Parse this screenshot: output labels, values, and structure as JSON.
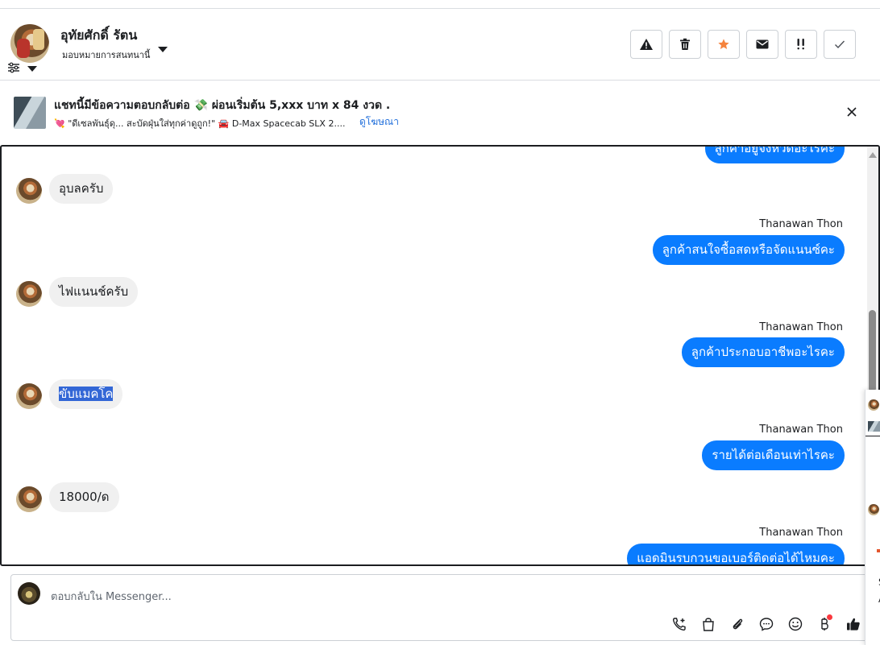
{
  "header": {
    "contact_name": "อุทัยศักดิ์ รัตน",
    "assign_label": "มอบหมายการสนทนานี้",
    "actions": [
      {
        "name": "spam-button",
        "icon": "warning-icon"
      },
      {
        "name": "delete-button",
        "icon": "trash-icon"
      },
      {
        "name": "star-button",
        "icon": "star-icon",
        "color": "#f5833d"
      },
      {
        "name": "mark-unread-button",
        "icon": "envelope-icon"
      },
      {
        "name": "follow-up-button",
        "icon": "double-exclamation-icon"
      },
      {
        "name": "mark-done-button",
        "icon": "check-icon"
      }
    ]
  },
  "ad_banner": {
    "title": "แชทนี้มีข้อความตอบกลับต่อ 💸 ผ่อนเริ่มต้น 5,xxx บาท x 84 งวด .",
    "subtitle": "💘 \"ดีเซลพันธุ์ดุ... สะบัดฝุ่นใส่ทุกค่าดูถูก!\" 🚘 D-Max Spacecab SLX 2....",
    "link": "ดูโฆษณา"
  },
  "messages": [
    {
      "direction": "out",
      "text": "ลูกค้าอยู่จังหวัดอะไรคะ"
    },
    {
      "direction": "in",
      "text": "อุบลครับ"
    },
    {
      "direction": "out",
      "sender": "Thanawan Thon",
      "text": "ลูกค้าสนใจซื้อสดหรือจัดแนนซ์คะ"
    },
    {
      "direction": "in",
      "text": "ไฟแนนช์ครับ"
    },
    {
      "direction": "out",
      "sender": "Thanawan Thon",
      "text": "ลูกค้าประกอบอาชีพอะไรคะ"
    },
    {
      "direction": "in",
      "text": "ขับแมคโค",
      "highlighted": true
    },
    {
      "direction": "out",
      "sender": "Thanawan Thon",
      "text": "รายได้ต่อเดือนเท่าไรคะ"
    },
    {
      "direction": "in",
      "text": "18000/ด"
    },
    {
      "direction": "out",
      "sender": "Thanawan Thon",
      "text": "แอดมินรบกวนขอเบอร์ติดต่อได้ไหมคะ"
    }
  ],
  "composer": {
    "placeholder": "ตอบกลับใน Messenger...",
    "tools": [
      "add-call-icon",
      "shopping-bag-icon",
      "paperclip-icon",
      "saved-reply-icon",
      "emoji-icon",
      "baht-icon",
      "thumbs-up-icon"
    ]
  },
  "edge_panel": {
    "partial_text_1": "S",
    "partial_text_2": "A"
  },
  "colors": {
    "outgoing_bubble": "#0a7cff",
    "incoming_bubble": "#f0f0f0",
    "link": "#216fdb",
    "selection": "#3367d6"
  }
}
